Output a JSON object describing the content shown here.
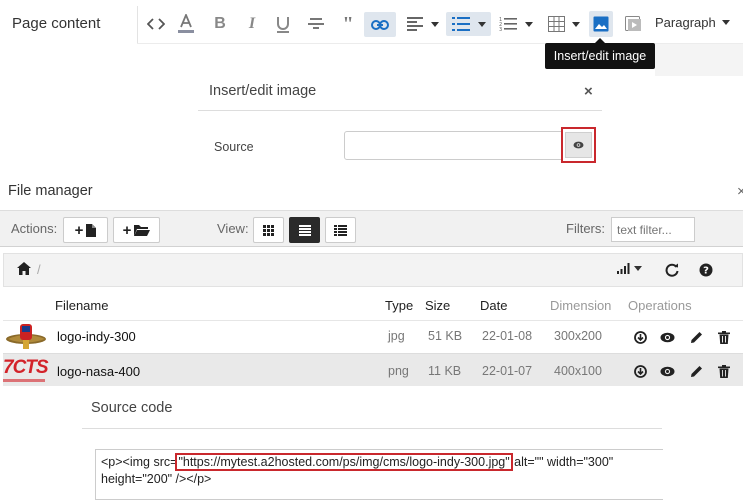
{
  "editor": {
    "page_label": "Page content",
    "paragraph_label": "Paragraph",
    "tooltip": "Insert/edit image",
    "toolbar_icons": [
      "code-icon",
      "text-color-icon",
      "bold-icon",
      "italic-icon",
      "underline-icon",
      "strikethrough-icon",
      "blockquote-icon",
      "link-icon",
      "align-left-icon",
      "bullet-list-icon",
      "numbered-list-icon",
      "table-icon",
      "image-icon",
      "media-icon"
    ]
  },
  "dialog": {
    "title": "Insert/edit image",
    "close": "×",
    "source_label": "Source",
    "source_value": ""
  },
  "file_manager": {
    "title": "File manager",
    "close": "×",
    "actions_label": "Actions:",
    "view_label": "View:",
    "filters_label": "Filters:",
    "filter_placeholder": "text filter...",
    "columns": {
      "filename": "Filename",
      "type": "Type",
      "size": "Size",
      "date": "Date",
      "dimension": "Dimension",
      "operations": "Operations"
    },
    "breadcrumb_sep": "/",
    "files": [
      {
        "name": "logo-indy-300",
        "type": "jpg",
        "size": "51 KB",
        "date": "22-01-08",
        "dimension": "300x200",
        "thumb_text": ""
      },
      {
        "name": "logo-nasa-400",
        "type": "png",
        "size": "11 KB",
        "date": "22-01-07",
        "dimension": "400x100",
        "thumb_text": "7CTS"
      }
    ]
  },
  "source_code": {
    "title": "Source code",
    "prefix": "<p><img src=",
    "url": "\"https://mytest.a2hosted.com/ps/img/cms/logo-indy-300.jpg\"",
    "suffix": " alt=\"\" width=\"300\"",
    "line2": "height=\"200\" /></p>"
  },
  "colors": {
    "accent_blue": "#1a6fc4",
    "highlight_red": "#c9282d",
    "tooltip_bg": "#121212"
  }
}
